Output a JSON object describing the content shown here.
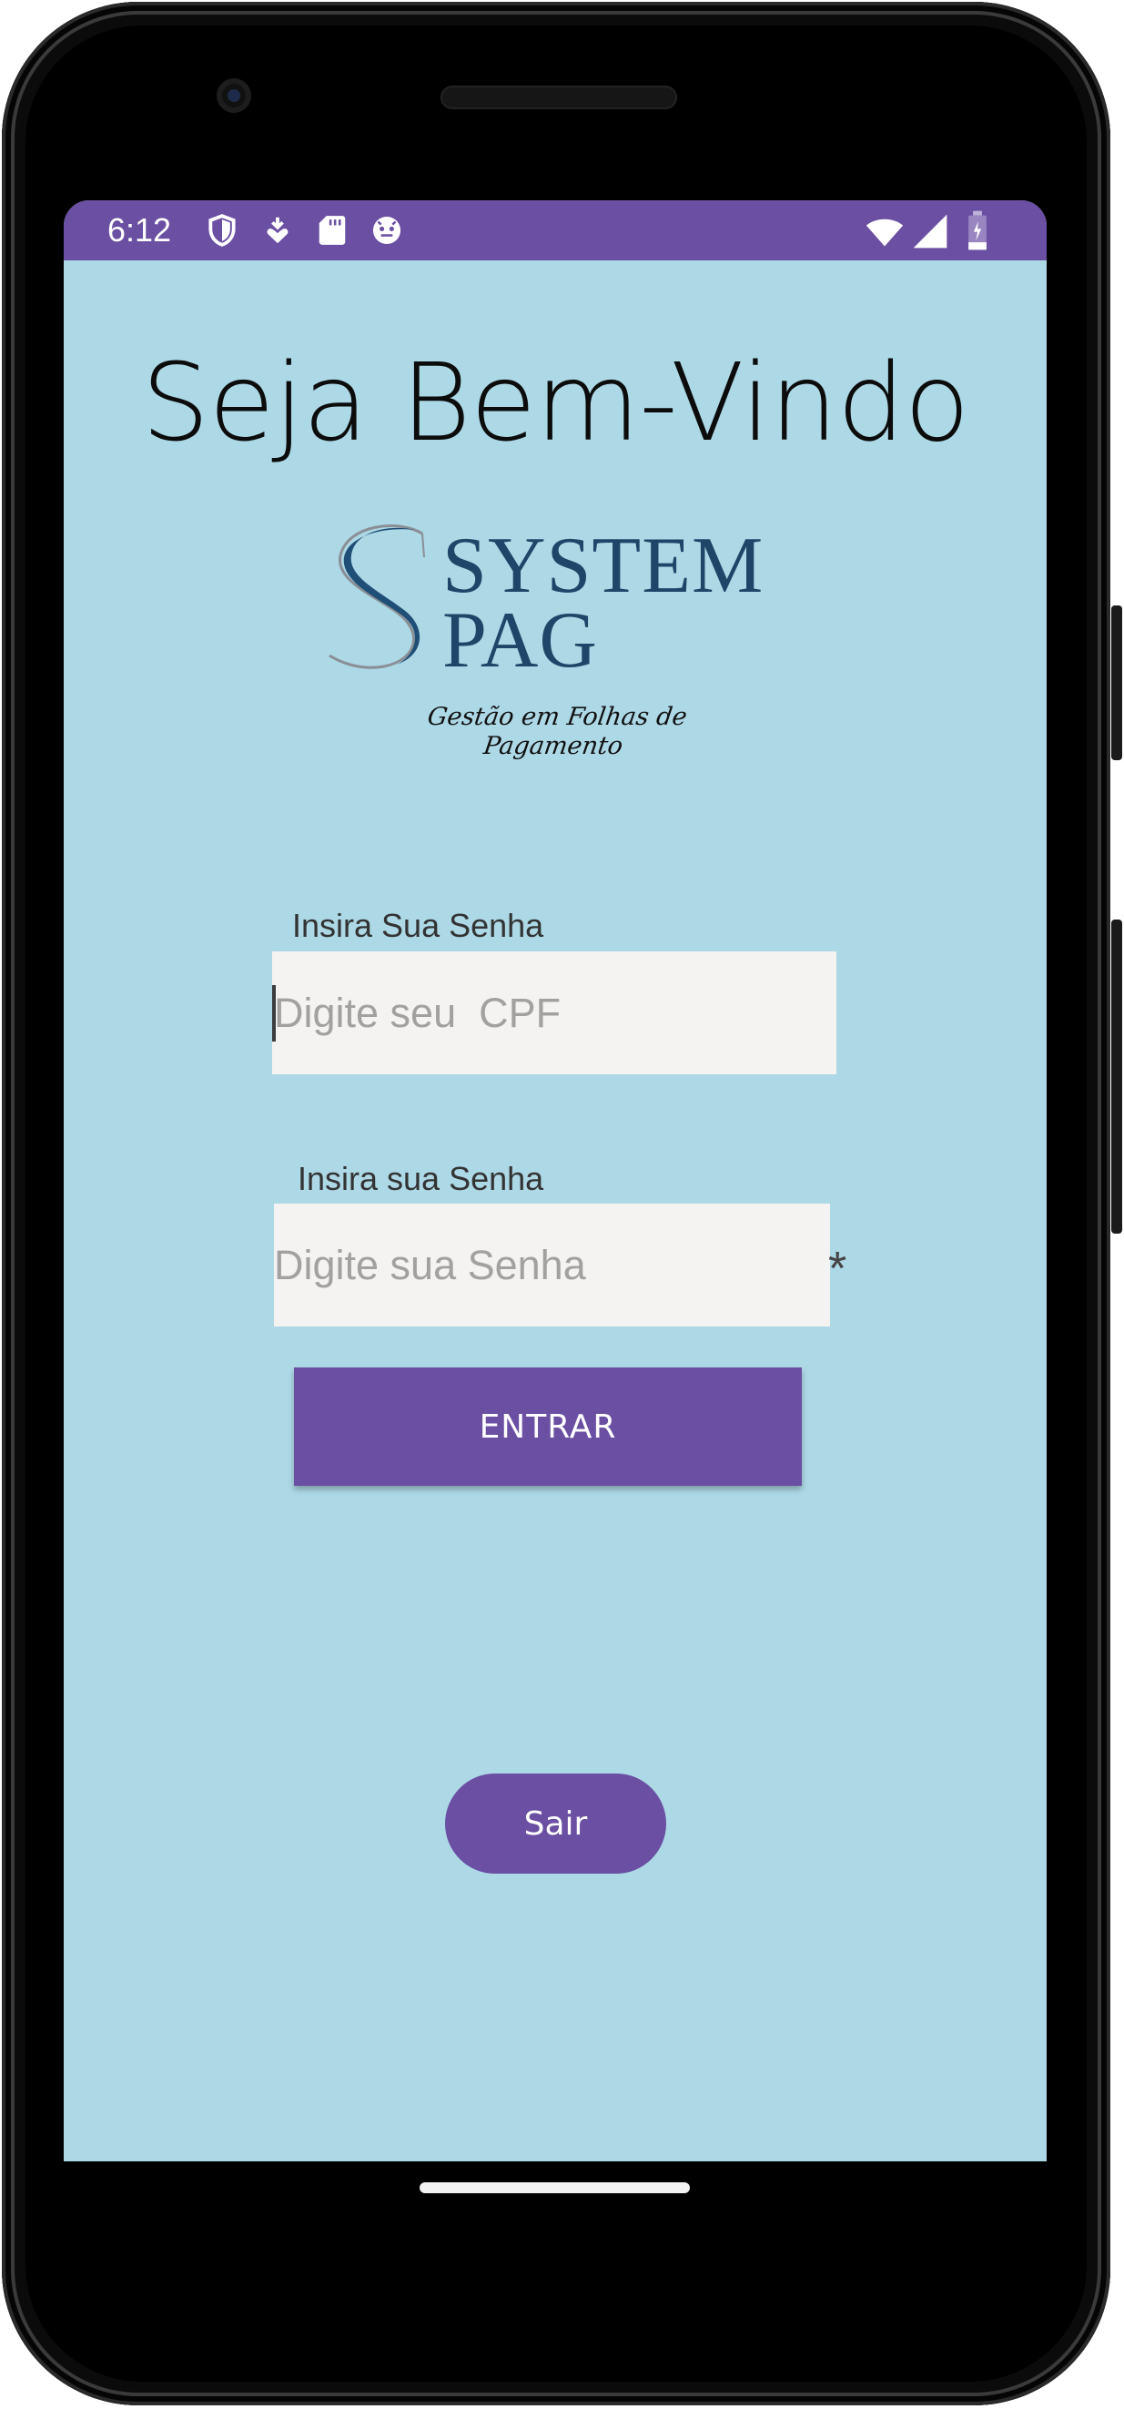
{
  "status_bar": {
    "time": "6:12",
    "left_icons": [
      "shield-icon",
      "download-heart-icon",
      "sd-card-icon",
      "android-face-icon"
    ],
    "right_icons": [
      "wifi-icon",
      "signal-icon",
      "battery-icon"
    ]
  },
  "welcome_title": "Seja Bem-Vindo",
  "logo": {
    "line1": "SYSTEM",
    "line2": "PAG",
    "tagline": "Gestão em Folhas de Pagamento"
  },
  "cpf_field": {
    "label": "Insira Sua Senha",
    "placeholder": "Digite seu  CPF",
    "value": ""
  },
  "password_field": {
    "label": "Insira sua Senha",
    "placeholder": "Digite sua Senha",
    "value": "",
    "required_mark": "*"
  },
  "enter_button": {
    "label": "ENTRAR"
  },
  "exit_button": {
    "label": "Sair"
  },
  "colors": {
    "accent": "#6a4fa3",
    "screen_background": "#add8e6",
    "input_background": "#f5f2f2",
    "logo_blue": "#1d4668"
  }
}
